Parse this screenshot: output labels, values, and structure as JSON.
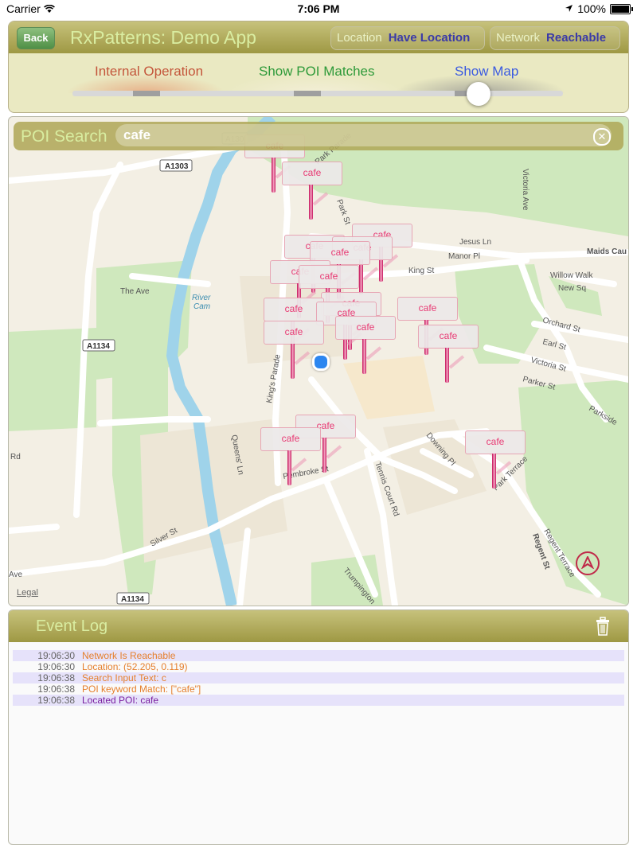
{
  "status_bar": {
    "carrier": "Carrier",
    "time": "7:06 PM",
    "battery": "100%"
  },
  "header": {
    "back_label": "Back",
    "app_title": "RxPatterns: Demo App",
    "location_label": "Location",
    "location_value": "Have Location",
    "network_label": "Network",
    "network_value": "Reachable"
  },
  "modes": {
    "items": [
      "Internal Operation",
      "Show POI Matches",
      "Show Map"
    ],
    "selected": "Show Map",
    "colors": {
      "internal": "#c4553a",
      "poi": "#2e9a3a",
      "map": "#3a5ae0"
    }
  },
  "search": {
    "label": "POI Search",
    "query": "cafe"
  },
  "map": {
    "poi_label": "cafe",
    "legal": "Legal",
    "road_labels": [
      "A1303",
      "A130",
      "A1134",
      "A1134",
      "Jesus Ln",
      "Manor Pl",
      "King St",
      "Maids Cau",
      "Willow Walk",
      "New Sq",
      "Victoria Ave",
      "Orchard St",
      "Earl St",
      "Victoria St",
      "Parker St",
      "Parkside",
      "The Ave",
      "River Cam",
      "King's Parade",
      "Queens' Ln",
      "Downing Pl",
      "Tennis Court Rd",
      "Park Terrace",
      "Regent Terrace",
      "Regent St",
      "Silver St",
      "Trumpington",
      "Pembroke St",
      "Rd",
      "Ave",
      "Park Parade",
      "Park St"
    ]
  },
  "event_log": {
    "title": "Event Log",
    "entries": [
      {
        "time": "19:06:30",
        "text": "Network Is Reachable",
        "color": "#e57f2c"
      },
      {
        "time": "19:06:30",
        "text": "Location: (52.205, 0.119)",
        "color": "#e57f2c"
      },
      {
        "time": "19:06:38",
        "text": "Search Input Text: c",
        "color": "#e57f2c"
      },
      {
        "time": "19:06:38",
        "text": "POI keyword Match: [\"cafe\"]",
        "color": "#e57f2c"
      },
      {
        "time": "19:06:38",
        "text": "Located POI: cafe",
        "color": "#7a1ea0"
      }
    ]
  }
}
